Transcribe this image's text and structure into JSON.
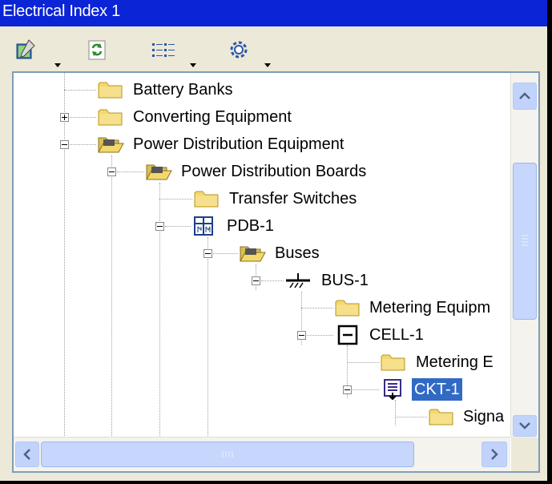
{
  "window": {
    "title": "Electrical Index 1"
  },
  "toolbar": {
    "buttons": [
      {
        "icon": "properties-icon",
        "has_dropdown": true
      },
      {
        "icon": "refresh-icon",
        "has_dropdown": false
      },
      {
        "icon": "view-list-icon",
        "has_dropdown": true
      },
      {
        "icon": "settings-icon",
        "has_dropdown": true
      }
    ]
  },
  "tree": {
    "nodes": [
      {
        "label": "Battery Banks",
        "icon": "folder-icon",
        "expander": "none"
      },
      {
        "label": "Converting Equipment",
        "icon": "folder-icon",
        "expander": "plus"
      },
      {
        "label": "Power Distribution Equipment",
        "icon": "folder-open-icon",
        "expander": "minus"
      },
      {
        "label": "Power Distribution Boards",
        "icon": "folder-open-icon",
        "expander": "minus"
      },
      {
        "label": "Transfer Switches",
        "icon": "folder-icon",
        "expander": "none"
      },
      {
        "label": "PDB-1",
        "icon": "distribution-board-icon",
        "expander": "minus"
      },
      {
        "label": "Buses",
        "icon": "folder-open-icon",
        "expander": "minus"
      },
      {
        "label": "BUS-1",
        "icon": "bus-icon",
        "expander": "minus"
      },
      {
        "label": "Metering Equipm",
        "icon": "folder-icon",
        "expander": "none"
      },
      {
        "label": "CELL-1",
        "icon": "cell-icon",
        "expander": "minus"
      },
      {
        "label": "Metering E",
        "icon": "folder-icon",
        "expander": "none"
      },
      {
        "label": "CKT-1",
        "icon": "circuit-icon",
        "expander": "minus",
        "selected": true
      },
      {
        "label": "Signa",
        "icon": "folder-icon",
        "expander": "none"
      }
    ]
  },
  "colors": {
    "titlebar": "#0a24d6",
    "selection": "#316ac5",
    "folder": "#f3d96b",
    "scrollbar": "#c1d3fb"
  }
}
